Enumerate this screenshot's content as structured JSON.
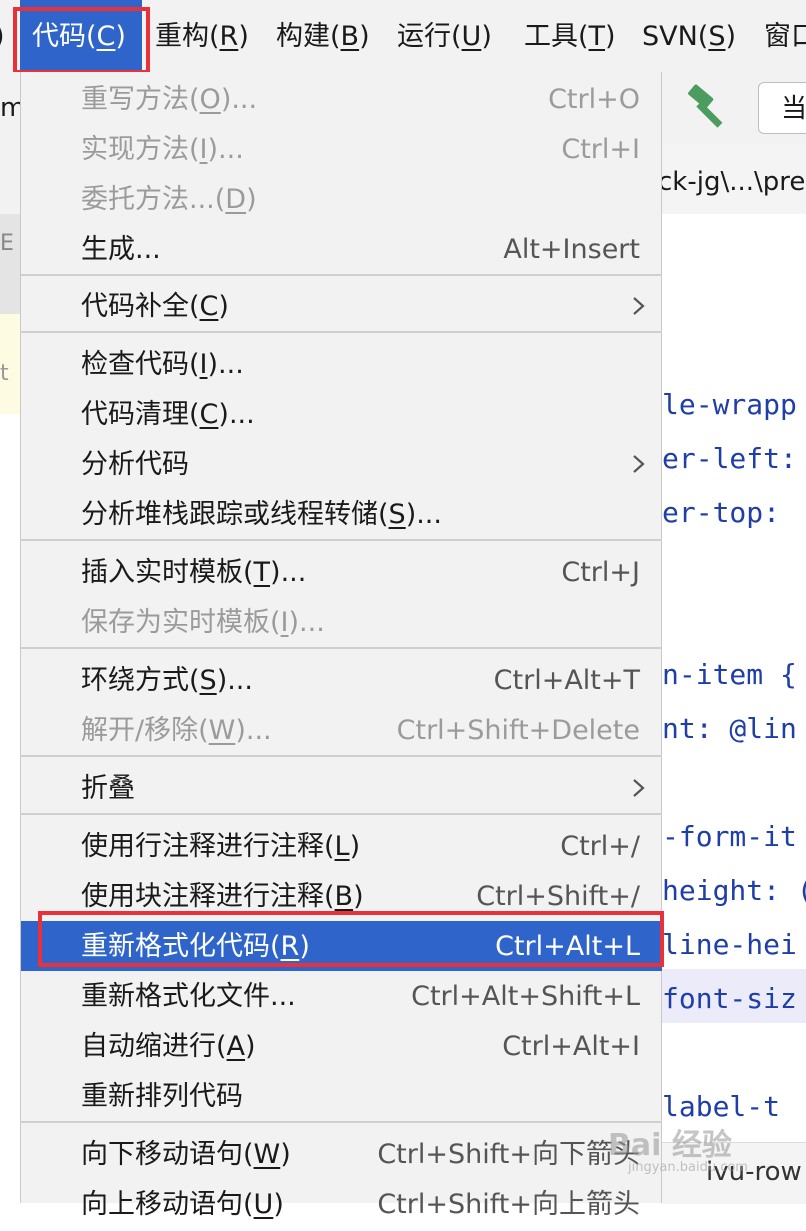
{
  "menubar": {
    "items": [
      {
        "pre": "代码(",
        "key": "C",
        "post": ")"
      },
      {
        "pre": "重构(",
        "key": "R",
        "post": ")"
      },
      {
        "pre": "构建(",
        "key": "B",
        "post": ")"
      },
      {
        "pre": "运行(",
        "key": "U",
        "post": ")"
      },
      {
        "pre": "工具(",
        "key": "T",
        "post": ")"
      },
      {
        "pre": "SVN(",
        "key": "S",
        "post": ")"
      },
      {
        "pre": "窗口",
        "key": "",
        "post": ""
      }
    ]
  },
  "toolbar": {
    "search_text": "当",
    "hammer_icon": "hammer-icon",
    "hammer_color": "#4d9c5f"
  },
  "path_bar": {
    "text": "ck-jg\\...\\pre"
  },
  "left_panel": {
    "t1": "m",
    "t2": "E",
    "t3": "t"
  },
  "editor": {
    "lines": [
      {
        "text": "le-wrapp"
      },
      {
        "text": "er-left:"
      },
      {
        "text": "er-top:"
      },
      {
        "text": "n-item {"
      },
      {
        "text": "nt: @lin"
      },
      {
        "text": "-form-it"
      },
      {
        "text": "height: ("
      },
      {
        "text": "line-hei"
      },
      {
        "text": "font-siz"
      },
      {
        "text": "label-t"
      }
    ],
    "bottom_tab": "ivu-row"
  },
  "watermark": {
    "main": "Bai 经验",
    "sub": "jingyan.baidu.com"
  },
  "menu": {
    "items": [
      {
        "pre": "重写方法(",
        "key": "O",
        "post": ")...",
        "shortcut": "Ctrl+O",
        "disabled": true
      },
      {
        "pre": "实现方法(",
        "key": "I",
        "post": ")...",
        "shortcut": "Ctrl+I",
        "disabled": true
      },
      {
        "pre": "委托方法...(",
        "key": "D",
        "post": ")",
        "shortcut": "",
        "disabled": true
      },
      {
        "pre": "生成...",
        "key": "",
        "post": "",
        "shortcut": "Alt+Insert",
        "disabled": false
      },
      {
        "pre": "代码补全(",
        "key": "C",
        "post": ")",
        "shortcut": "",
        "disabled": false,
        "submenu": true
      },
      {
        "pre": "检查代码(",
        "key": "I",
        "post": ")...",
        "shortcut": "",
        "disabled": false
      },
      {
        "pre": "代码清理(",
        "key": "C",
        "post": ")...",
        "shortcut": "",
        "disabled": false
      },
      {
        "pre": "分析代码",
        "key": "",
        "post": "",
        "shortcut": "",
        "disabled": false,
        "submenu": true
      },
      {
        "pre": "分析堆栈跟踪或线程转储(",
        "key": "S",
        "post": ")...",
        "shortcut": "",
        "disabled": false
      },
      {
        "pre": "插入实时模板(",
        "key": "T",
        "post": ")...",
        "shortcut": "Ctrl+J",
        "disabled": false
      },
      {
        "pre": "保存为实时模板(",
        "key": "I",
        "post": ")...",
        "shortcut": "",
        "disabled": true
      },
      {
        "pre": "环绕方式(",
        "key": "S",
        "post": ")...",
        "shortcut": "Ctrl+Alt+T",
        "disabled": false
      },
      {
        "pre": "解开/移除(",
        "key": "W",
        "post": ")...",
        "shortcut": "Ctrl+Shift+Delete",
        "disabled": true
      },
      {
        "pre": "折叠",
        "key": "",
        "post": "",
        "shortcut": "",
        "disabled": false,
        "submenu": true
      },
      {
        "pre": "使用行注释进行注释(",
        "key": "L",
        "post": ")",
        "shortcut": "Ctrl+/",
        "disabled": false
      },
      {
        "pre": "使用块注释进行注释(",
        "key": "B",
        "post": ")",
        "shortcut": "Ctrl+Shift+/",
        "disabled": false
      },
      {
        "pre": "重新格式化代码(",
        "key": "R",
        "post": ")",
        "shortcut": "Ctrl+Alt+L",
        "disabled": false,
        "selected": true
      },
      {
        "pre": "重新格式化文件...",
        "key": "",
        "post": "",
        "shortcut": "Ctrl+Alt+Shift+L",
        "disabled": false
      },
      {
        "pre": "自动缩进行(",
        "key": "A",
        "post": ")",
        "shortcut": "Ctrl+Alt+I",
        "disabled": false
      },
      {
        "pre": "重新排列代码",
        "key": "",
        "post": "",
        "shortcut": "",
        "disabled": false
      },
      {
        "pre": "向下移动语句(",
        "key": "W",
        "post": ")",
        "shortcut": "Ctrl+Shift+向下箭头",
        "disabled": false
      },
      {
        "pre": "向上移动语句(",
        "key": "U",
        "post": ")",
        "shortcut": "Ctrl+Shift+向上箭头",
        "disabled": false
      }
    ]
  },
  "colors": {
    "highlight_box": "#e8313a",
    "selection": "#2f65ca"
  }
}
